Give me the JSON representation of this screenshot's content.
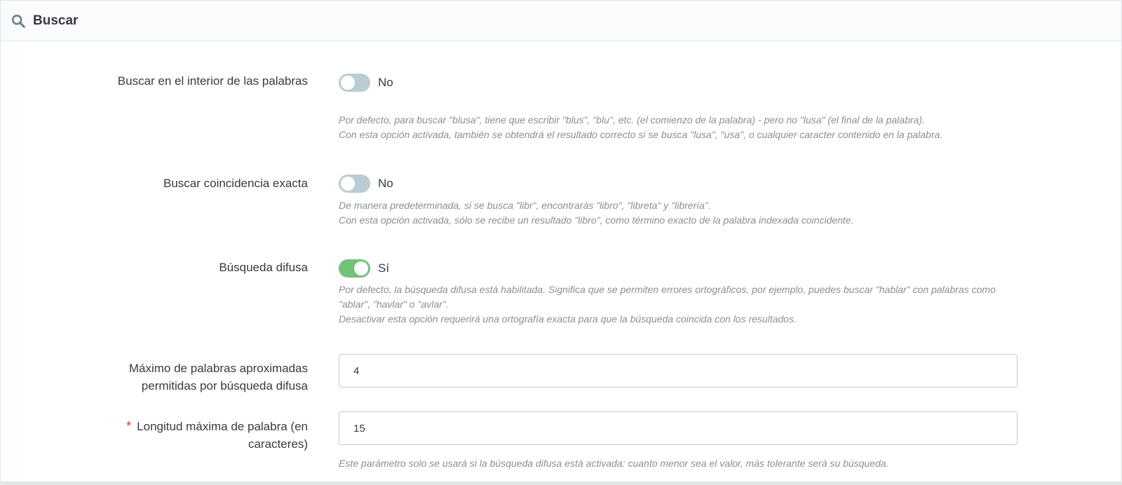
{
  "header": {
    "title": "Buscar",
    "icon": "search-icon"
  },
  "settings": {
    "inner_word": {
      "label": "Buscar en el interior de las palabras",
      "state": "No",
      "enabled": false,
      "help": [
        "Por defecto, para buscar \"blusa\", tiene que escribir \"blus\", \"blu\", etc. (el comienzo de la palabra) - pero no \"lusa\" (el final de la palabra).",
        "Con esta opción activada, también se obtendrá el resultado correcto si se busca \"lusa\", \"usa\", o cualquier caracter contenido en la palabra."
      ]
    },
    "exact_match": {
      "label": "Buscar coincidencia exacta",
      "state": "No",
      "enabled": false,
      "help": [
        "De manera predeterminada, si se busca \"libr\", encontrarás \"libro\", \"libreta\" y \"librería\".",
        "Con esta opción activada, sólo se recibe un resultado \"libro\", como término exacto de la palabra indexada coincidente."
      ]
    },
    "fuzzy": {
      "label": "Búsqueda difusa",
      "state": "Sí",
      "enabled": true,
      "help": [
        "Por defecto, la búsqueda difusa está habilitada. Significa que se permiten errores ortográficos, por ejemplo, puedes buscar \"hablar\" con palabras como \"ablar\", \"havlar\" o \"avlar\".",
        "Desactivar esta opción requerirá una ortografía exacta para que la búsqueda coincida con los resultados."
      ]
    },
    "max_approx_words": {
      "label": "Máximo de palabras aproximadas permitidas por búsqueda difusa",
      "value": "4"
    },
    "max_word_length": {
      "required_mark": "*",
      "label": "Longitud máxima de palabra (en caracteres)",
      "value": "15",
      "help": "Este parámetro solo se usará si la búsqueda difusa está activada: cuanto menor sea el valor, más tolerante será su búsqueda."
    }
  },
  "colors": {
    "toggle_off": "#bbcdd2",
    "toggle_on": "#72c279",
    "required": "#e52d2d"
  }
}
